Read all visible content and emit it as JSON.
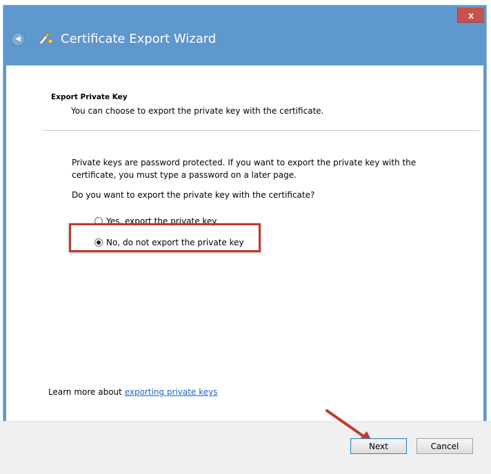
{
  "window": {
    "title": "Certificate Export Wizard",
    "close_symbol": "x",
    "back_icon": "back-arrow-icon",
    "wizard_icon": "certificate-wizard-icon"
  },
  "header": {
    "title": "Export Private Key",
    "subtitle": "You can choose to export the private key with the certificate."
  },
  "body": {
    "info": "Private keys are password protected. If you want to export the private key with the certificate, you must type a password on a later page.",
    "question": "Do you want to export the private key with the certificate?",
    "options": [
      {
        "label": "Yes, export the private key",
        "selected": false
      },
      {
        "label": "No, do not export the private key",
        "selected": true
      }
    ]
  },
  "learn_more": {
    "prefix": "Learn more about ",
    "link": "exporting private keys"
  },
  "footer": {
    "next_label": "Next",
    "cancel_label": "Cancel"
  },
  "colors": {
    "title_bar": "#5f97cf",
    "close_button": "#c7524b",
    "highlight_box": "#c0392b",
    "link": "#1a64c4"
  }
}
